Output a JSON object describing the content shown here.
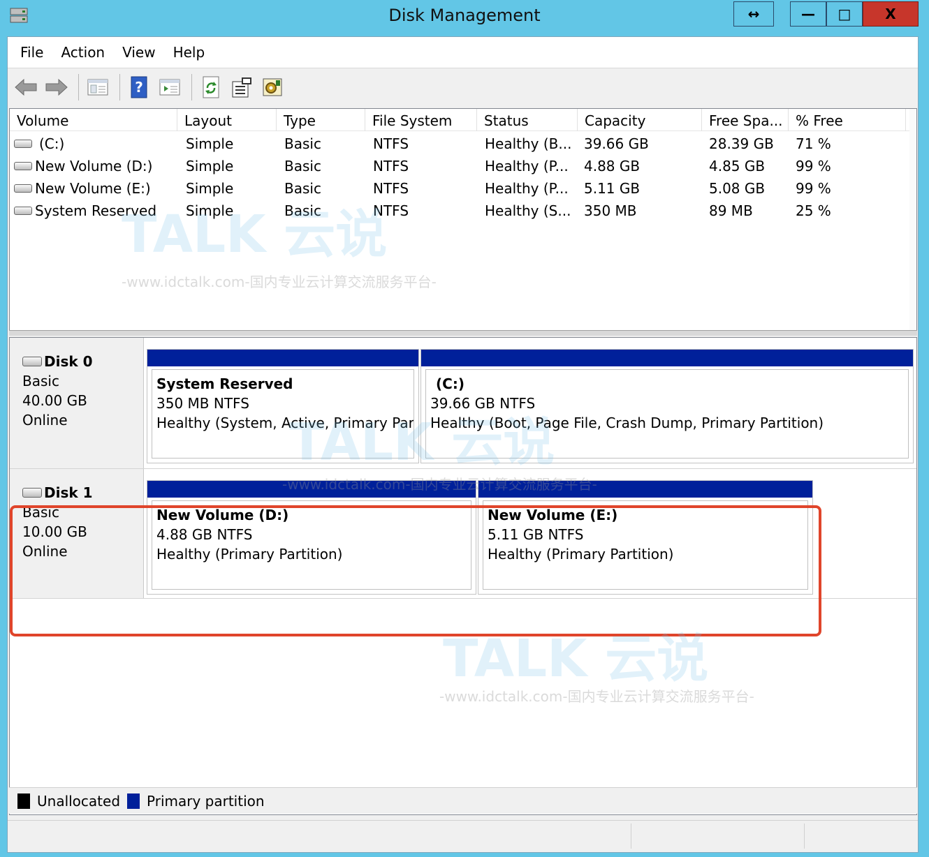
{
  "window": {
    "title": "Disk Management",
    "caption_restore": "↔",
    "caption_min": "—",
    "caption_max": "□",
    "caption_close": "X"
  },
  "menubar": {
    "items": [
      "File",
      "Action",
      "View",
      "Help"
    ]
  },
  "toolbar": {
    "buttons": [
      "back-icon",
      "forward-icon",
      "console-tree-icon",
      "help-icon",
      "properties-view-icon",
      "refresh-icon",
      "properties-icon",
      "settings-icon"
    ]
  },
  "volume_list": {
    "columns": [
      "Volume",
      "Layout",
      "Type",
      "File System",
      "Status",
      "Capacity",
      "Free Spa...",
      "% Free"
    ],
    "rows": [
      {
        "volume": "(C:)",
        "layout": "Simple",
        "type": "Basic",
        "fs": "NTFS",
        "status": "Healthy (B...",
        "capacity": "39.66 GB",
        "free": "28.39 GB",
        "pct": "71 %"
      },
      {
        "volume": "New Volume (D:)",
        "layout": "Simple",
        "type": "Basic",
        "fs": "NTFS",
        "status": "Healthy (P...",
        "capacity": "4.88 GB",
        "free": "4.85 GB",
        "pct": "99 %"
      },
      {
        "volume": "New Volume (E:)",
        "layout": "Simple",
        "type": "Basic",
        "fs": "NTFS",
        "status": "Healthy (P...",
        "capacity": "5.11 GB",
        "free": "5.08 GB",
        "pct": "99 %"
      },
      {
        "volume": "System Reserved",
        "layout": "Simple",
        "type": "Basic",
        "fs": "NTFS",
        "status": "Healthy (S...",
        "capacity": "350 MB",
        "free": "89 MB",
        "pct": "25 %"
      }
    ]
  },
  "disks": [
    {
      "name": "Disk 0",
      "type": "Basic",
      "size": "40.00 GB",
      "state": "Online",
      "partitions": [
        {
          "title": "System Reserved",
          "size": "350 MB NTFS",
          "status": "Healthy (System, Active, Primary Part"
        },
        {
          "title": "(C:)",
          "size": "39.66 GB NTFS",
          "status": "Healthy (Boot, Page File, Crash Dump, Primary Partition)"
        }
      ]
    },
    {
      "name": "Disk 1",
      "type": "Basic",
      "size": "10.00 GB",
      "state": "Online",
      "partitions": [
        {
          "title": "New Volume  (D:)",
          "size": "4.88 GB NTFS",
          "status": "Healthy (Primary Partition)"
        },
        {
          "title": "New Volume  (E:)",
          "size": "5.11 GB NTFS",
          "status": "Healthy (Primary Partition)"
        }
      ]
    }
  ],
  "legend": {
    "unallocated": "Unallocated",
    "primary": "Primary partition",
    "unallocated_color": "#000000",
    "primary_color": "#00209a"
  },
  "watermark": {
    "brand": "TALK 云说",
    "url": "-www.idctalk.com-国内专业云计算交流服务平台-"
  },
  "colors": {
    "frame": "#62c6e6",
    "highlight": "#e0452b",
    "partition_bar": "#00209a"
  }
}
